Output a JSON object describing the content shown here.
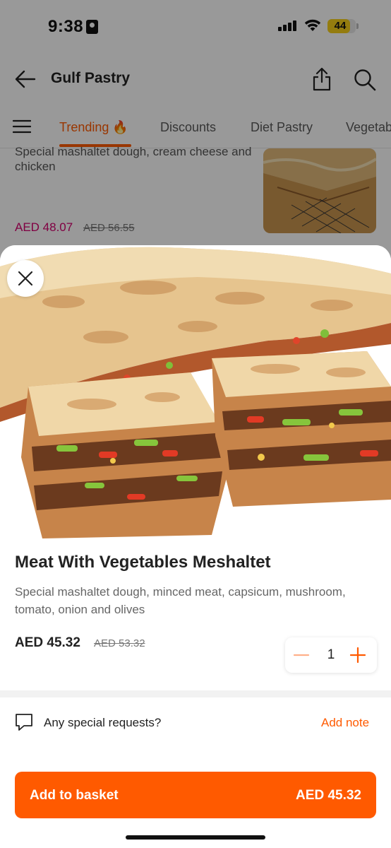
{
  "status_bar": {
    "time": "9:38",
    "battery": "44",
    "battery_level": 0.44
  },
  "header": {
    "title": "Gulf Pastry",
    "back_icon": "arrow-left-icon",
    "share_icon": "share-icon",
    "search_icon": "search-icon"
  },
  "tabs": {
    "menu_icon": "hamburger-icon",
    "items": [
      {
        "label": "Trending 🔥",
        "active": true
      },
      {
        "label": "Discounts",
        "active": false
      },
      {
        "label": "Diet Pastry",
        "active": false
      },
      {
        "label": "Vegetab",
        "active": false
      }
    ]
  },
  "background_item": {
    "description": "Special mashaltet dough, cream cheese and chicken",
    "price": "AED 48.07",
    "old_price": "AED 56.55"
  },
  "product": {
    "name": "Meat With Vegetables Meshaltet",
    "description": "Special mashaltet dough, minced meat, capsicum, mushroom, tomato, onion and olives",
    "price": "AED 45.32",
    "old_price": "AED 53.32",
    "quantity": "1"
  },
  "special_requests": {
    "label": "Any special requests?",
    "action": "Add note",
    "icon": "comment-icon"
  },
  "basket": {
    "label": "Add to basket",
    "price": "AED 45.32"
  },
  "colors": {
    "accent": "#ff5a00",
    "price_pink": "#d6006e",
    "battery": "#f7cf1a"
  }
}
